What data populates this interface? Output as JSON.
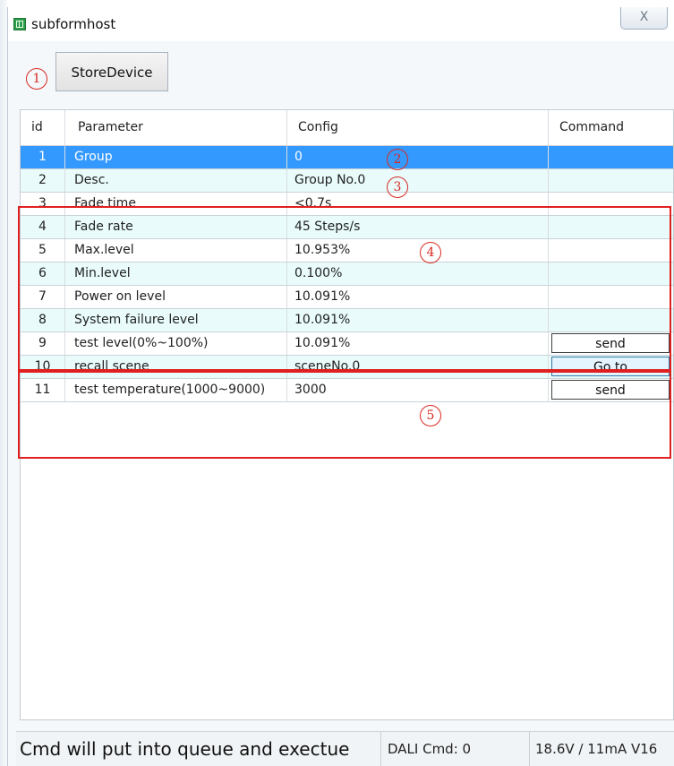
{
  "window": {
    "title": "subformhost",
    "close_label": "X"
  },
  "toolbar": {
    "store_label": "StoreDevice"
  },
  "markers": [
    "1",
    "2",
    "3",
    "4",
    "5"
  ],
  "table": {
    "columns": [
      "id",
      "Parameter",
      "Config",
      "Command"
    ],
    "rows": [
      {
        "id": "1",
        "parameter": "Group",
        "config": "0",
        "command": ""
      },
      {
        "id": "2",
        "parameter": "Desc.",
        "config": "Group No.0",
        "command": ""
      },
      {
        "id": "3",
        "parameter": "Fade time",
        "config": "<0.7s",
        "command": ""
      },
      {
        "id": "4",
        "parameter": "Fade rate",
        "config": "45 Steps/s",
        "command": ""
      },
      {
        "id": "5",
        "parameter": "Max.level",
        "config": "10.953%",
        "command": ""
      },
      {
        "id": "6",
        "parameter": "Min.level",
        "config": "0.100%",
        "command": ""
      },
      {
        "id": "7",
        "parameter": "Power on level",
        "config": "10.091%",
        "command": ""
      },
      {
        "id": "8",
        "parameter": "System failure level",
        "config": "10.091%",
        "command": ""
      },
      {
        "id": "9",
        "parameter": "test level(0%~100%)",
        "config": "10.091%",
        "command": "send"
      },
      {
        "id": "10",
        "parameter": "recall scene",
        "config": "sceneNo.0",
        "command": "Go to"
      },
      {
        "id": "11",
        "parameter": "test temperature(1000~9000)",
        "config": "3000",
        "command": "send"
      }
    ]
  },
  "status": {
    "message": "Cmd will put into queue and exectue",
    "dali_cmd": "DALI Cmd: 0",
    "power": "18.6V / 11mA V16"
  },
  "colors": {
    "selected_row": "#3399ff",
    "alt_row": "#e9fbfb",
    "annotation_red": "#e02020"
  }
}
